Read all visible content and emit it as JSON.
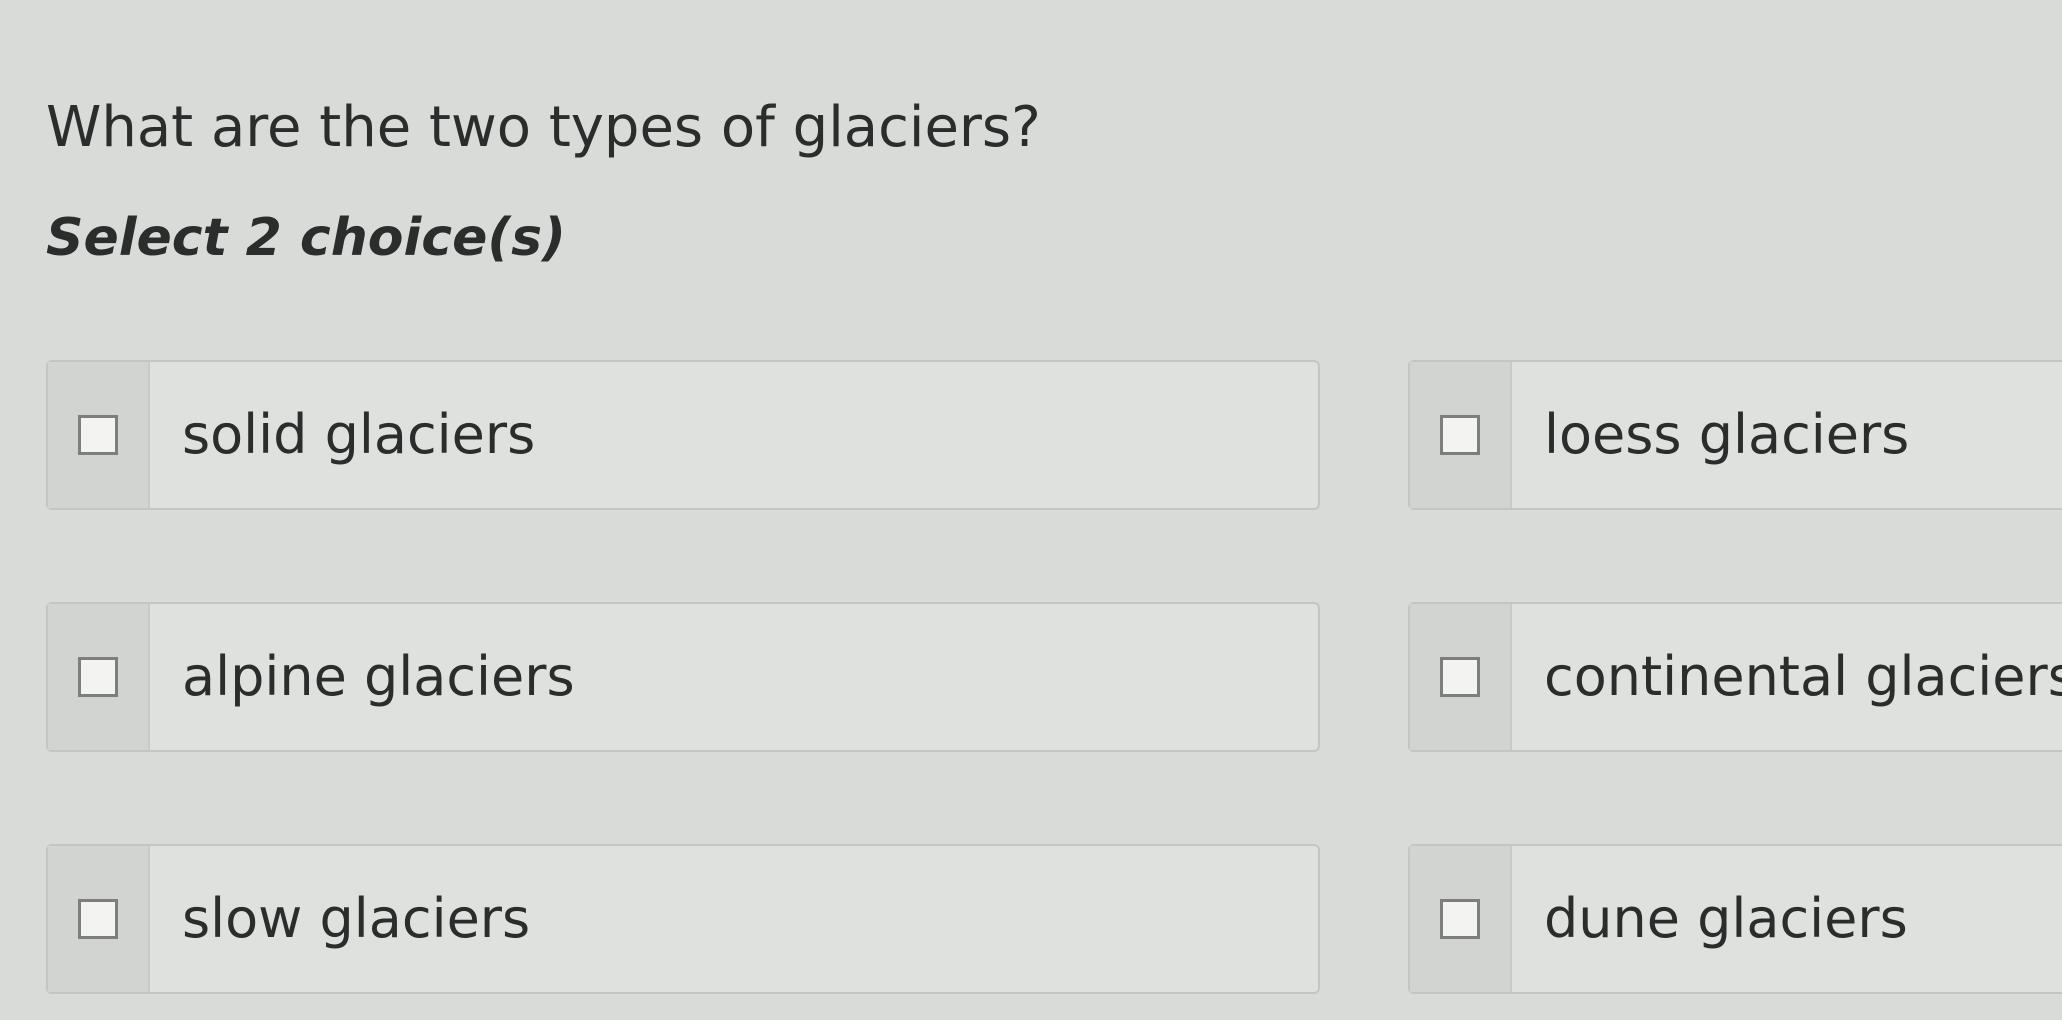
{
  "question": {
    "text": "What are the two types of glaciers?"
  },
  "instruction": {
    "text": "Select 2 choice(s)"
  },
  "choices": [
    {
      "label": "solid glaciers",
      "checked": false
    },
    {
      "label": "loess glaciers",
      "checked": false
    },
    {
      "label": "alpine glaciers",
      "checked": false
    },
    {
      "label": "continental glaciers",
      "checked": false
    },
    {
      "label": "slow glaciers",
      "checked": false
    },
    {
      "label": "dune glaciers",
      "checked": false
    }
  ]
}
